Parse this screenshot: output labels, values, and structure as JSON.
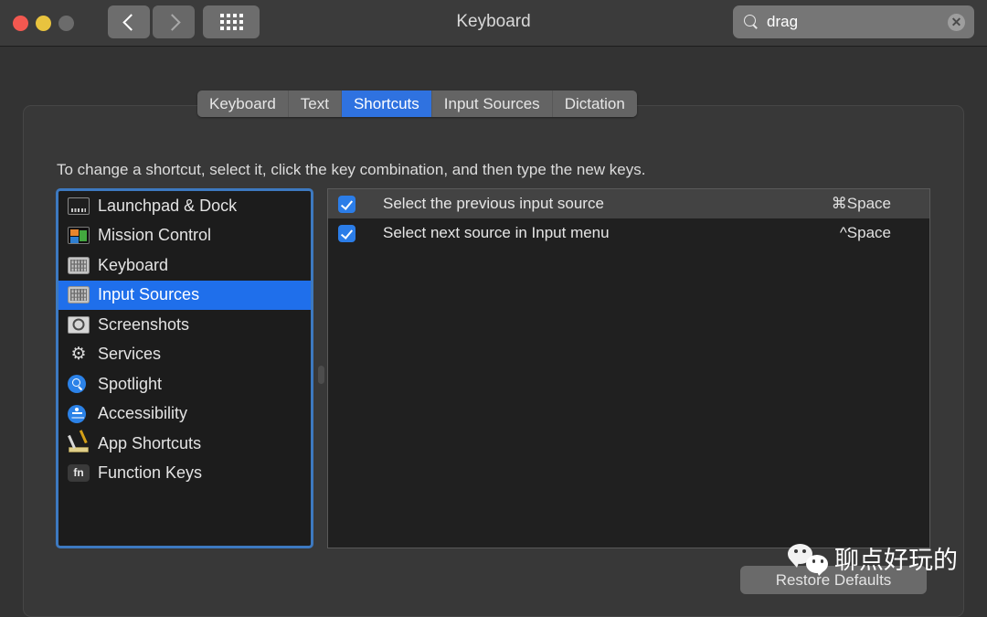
{
  "window": {
    "title": "Keyboard",
    "traffic_lights": [
      "close-red",
      "minimize-yellow",
      "zoom-gray"
    ],
    "back_label": "‹",
    "forward_label": "›",
    "grid_label": "show-all-grid"
  },
  "search": {
    "value": "drag",
    "placeholder": "Search",
    "clear_label": "✕"
  },
  "tabs": [
    {
      "label": "Keyboard",
      "active": false
    },
    {
      "label": "Text",
      "active": false
    },
    {
      "label": "Shortcuts",
      "active": true
    },
    {
      "label": "Input Sources",
      "active": false
    },
    {
      "label": "Dictation",
      "active": false
    }
  ],
  "instruction": "To change a shortcut, select it, click the key combination, and then type the new keys.",
  "sidebar": {
    "items": [
      {
        "label": "Launchpad & Dock",
        "icon": "launchpad-dock-icon",
        "selected": false
      },
      {
        "label": "Mission Control",
        "icon": "mission-control-icon",
        "selected": false
      },
      {
        "label": "Keyboard",
        "icon": "keyboard-icon",
        "selected": false
      },
      {
        "label": "Input Sources",
        "icon": "input-sources-keyboard-icon",
        "selected": true
      },
      {
        "label": "Screenshots",
        "icon": "screenshots-camera-icon",
        "selected": false
      },
      {
        "label": "Services",
        "icon": "services-gear-icon",
        "selected": false
      },
      {
        "label": "Spotlight",
        "icon": "spotlight-magnifier-icon",
        "selected": false
      },
      {
        "label": "Accessibility",
        "icon": "accessibility-person-icon",
        "selected": false
      },
      {
        "label": "App Shortcuts",
        "icon": "app-shortcuts-ruler-pencil-icon",
        "selected": false
      },
      {
        "label": "Function Keys",
        "icon": "function-keys-fn-icon",
        "selected": false
      }
    ]
  },
  "shortcuts": {
    "rows": [
      {
        "checked": true,
        "label": "Select the previous input source",
        "keys": "⌘Space",
        "highlight": true
      },
      {
        "checked": true,
        "label": "Select next source in Input menu",
        "keys": "^Space",
        "highlight": false
      }
    ]
  },
  "buttons": {
    "restore_defaults": "Restore Defaults"
  },
  "watermark": {
    "text": "聊点好玩的",
    "icon": "wechat-logo-icon"
  },
  "colors": {
    "accent_blue": "#1f6feb",
    "tab_active_blue": "#2f72e0",
    "checkbox_blue": "#2b7de8",
    "focus_ring": "#3d79c0",
    "window_bg": "#333333",
    "titlebar_bg": "#3b3b3b",
    "pane_bg": "#383838",
    "list_bg": "#202020",
    "sidebar_bg": "#1c1c1c"
  }
}
